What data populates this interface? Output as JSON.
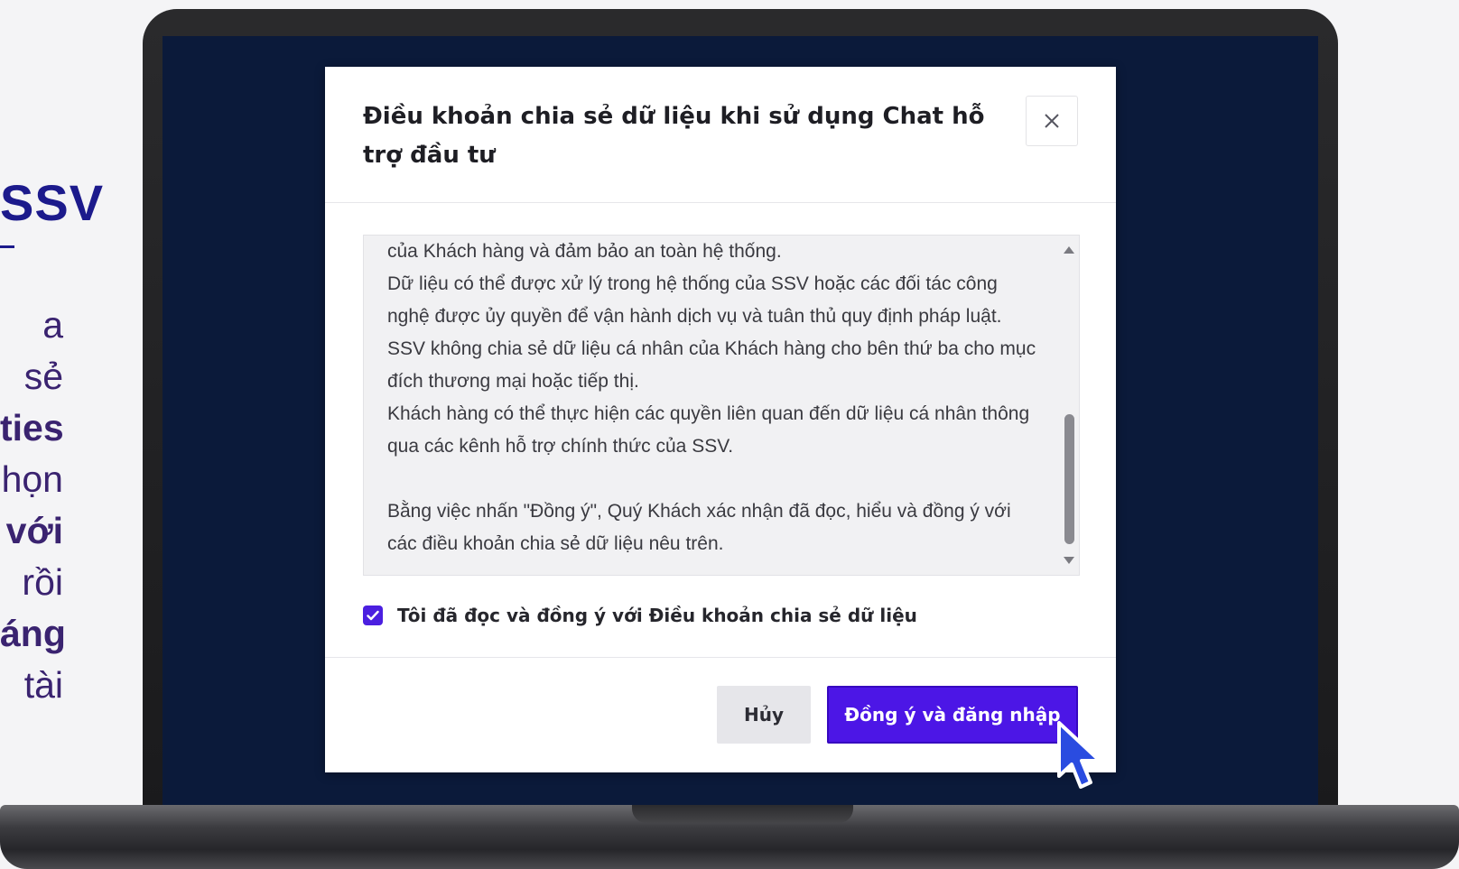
{
  "side_panel": {
    "title": "SSV",
    "lines": [
      {
        "text": "a sẻ",
        "bold": false
      },
      {
        "text": "ties",
        "bold": true
      },
      {
        "text": "họn",
        "bold": false
      },
      {
        "text": "với",
        "bold": true
      },
      {
        "text": "rồi",
        "bold": false
      },
      {
        "text": "áng",
        "bold": true
      },
      {
        "text": "tài",
        "bold": false
      }
    ]
  },
  "dialog": {
    "title": "Điều khoản chia sẻ dữ liệu khi sử dụng Chat hỗ trợ đầu tư",
    "close_icon": "close-icon",
    "terms_text": "của Khách hàng và đảm bảo an toàn hệ thống.\nDữ liệu có thể được xử lý trong hệ thống của SSV hoặc các đối tác công nghệ được ủy quyền để vận hành dịch vụ và tuân thủ quy định pháp luật.\nSSV không chia sẻ dữ liệu cá nhân của Khách hàng cho bên thứ ba cho mục đích thương mại hoặc tiếp thị.\nKhách hàng có thể thực hiện các quyền liên quan đến dữ liệu cá nhân thông qua các kênh hỗ trợ chính thức của SSV.\n\nBằng việc nhấn \"Đồng ý\", Quý Khách xác nhận đã đọc, hiểu và đồng ý với các điều khoản chia sẻ dữ liệu nêu trên.",
    "consent": {
      "checked": true,
      "label": "Tôi đã đọc và đồng ý với Điều khoản chia sẻ dữ liệu"
    },
    "buttons": {
      "cancel_label": "Hủy",
      "confirm_label": "Đồng ý và đăng nhập"
    }
  },
  "colors": {
    "accent": "#4c16e6",
    "screen_bg": "#0b1a3a",
    "side_title": "#1c1a8c"
  }
}
